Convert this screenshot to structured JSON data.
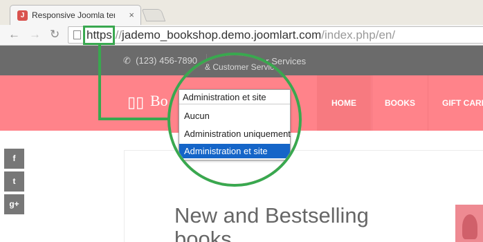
{
  "browser": {
    "tab_title": "Responsive Joomla template",
    "tab_close": "×",
    "url_scheme": "https:",
    "url_slashes": "//",
    "url_host": "jademo_bookshop.demo.joomlart.com",
    "url_path": "/index.php/en/",
    "back": "←",
    "forward": "→",
    "reload": "↻"
  },
  "site": {
    "phone": "(123) 456-7890",
    "services_text": "& Customer Services",
    "logo_text": "Bo",
    "nav": {
      "home": "HOME",
      "books": "BOOKS",
      "gift": "GIFT CARD"
    },
    "headline": "New and Bestselling books",
    "social": {
      "facebook": "f",
      "twitter": "t",
      "google": "g+"
    }
  },
  "dropdown": {
    "current_value": "Administration et site",
    "options": [
      "Aucun",
      "Administration uniquement",
      "Administration et site"
    ],
    "selected_index": 2
  },
  "colors": {
    "highlight": "#39a84f",
    "header": "#ff838a",
    "topbar": "#6b6b6b",
    "selected": "#1565c8"
  }
}
